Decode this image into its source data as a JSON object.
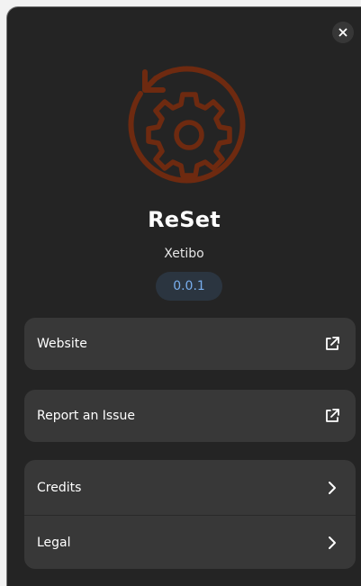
{
  "about": {
    "app_name": "ReSet",
    "developer": "Xetibo",
    "version": "0.0.1"
  },
  "icons": {
    "close": "close-icon",
    "app": "reset-gear-icon",
    "external_link": "external-link-icon",
    "chevron": "chevron-right-icon"
  },
  "colors": {
    "window_bg": "#242424",
    "card_bg": "#383838",
    "version_text": "#78aeed",
    "icon_brown": "#6e2a10"
  },
  "links": [
    {
      "label": "Website"
    },
    {
      "label": "Report an Issue"
    }
  ],
  "nav": [
    {
      "label": "Credits"
    },
    {
      "label": "Legal"
    }
  ]
}
